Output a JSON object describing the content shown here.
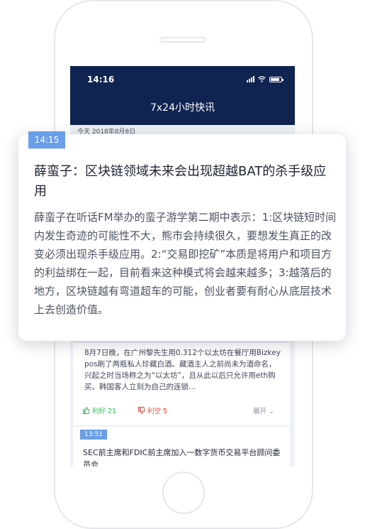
{
  "status_bar": {
    "time": "14:16"
  },
  "nav": {
    "title": "7x24小时快讯"
  },
  "date_label": "今天 2018年8月8日",
  "popup": {
    "time_flag": "14:15",
    "headline": "薛蛮子：区块链领域未来会出现超越BAT的杀手级应用",
    "body": "薛蛮子在听话FM举办的蛮子游学第二期中表示：1:区块链短时间内发生奇迹的可能性不大，熊市会持续很久，要想发生真正的改变必须出现杀手级应用。2:“交易即挖矿”本质是将用户和项目方的利益绑在一起，目前看来这种模式将会越来越多；3:越落后的地方，区块链越有弯道超车的可能，创业者要有耐心从底层技术上去创造价值。"
  },
  "news_card": {
    "body": "8月7日晚，在广州黎先生用0.312个以太坊在餐厅用Bizkey pos刷了两瓶私人珍藏白酒。藏酒主人之前尚未为酒命名，兴起之时当场称之为“以太坊”，且从此以后只允许用eth购买。韩国客人立刻为自己的连锁...",
    "bullish_label": "利好 21",
    "bearish_label": "利空 5",
    "expand_label": "展开"
  },
  "next_card": {
    "time_flag": "13:51",
    "headline": "SEC前主席和FDIC前主席加入一数字货币交易平台顾问委员会"
  },
  "colors": {
    "nav_bg": "#102451",
    "flag": "#6a9ee8",
    "bullish": "#31b553",
    "bearish": "#e4453c"
  }
}
